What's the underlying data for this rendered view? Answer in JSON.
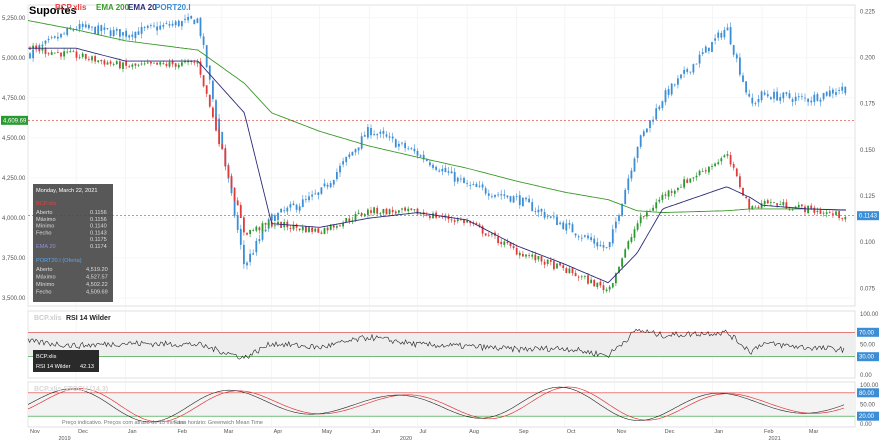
{
  "title": "Suportes",
  "legend": [
    {
      "label": "BCP.xlis",
      "color": "#e8403f"
    },
    {
      "label": "EMA 200",
      "color": "#3a9a2a"
    },
    {
      "label": "EMA 20",
      "color": "#2a2a7a"
    },
    {
      "label": "PORT20.I",
      "color": "#3b8ed6"
    }
  ],
  "colors": {
    "up": "#2a9a30",
    "down": "#e03a3a",
    "index": "#3b8ed6",
    "ema200": "#3a9a2a",
    "ema20": "#2a2a7a",
    "rsi": "#222222",
    "stoch_k": "#222222",
    "stoch_d": "#e03a3a"
  },
  "tooltip": {
    "date": "Monday, March 22, 2021",
    "bcp_label": "BCP.xlis",
    "bcp_rows": [
      [
        "Aberto",
        "0.1156"
      ],
      [
        "Máximo",
        "0.1156"
      ],
      [
        "Mínimo",
        "0.1140"
      ],
      [
        "Fecho",
        "0.1143"
      ]
    ],
    "ema200_value": "0.1175",
    "ema20_label": "EMA 20",
    "ema20_value": "0.1174",
    "port_label": "PORT20.I (Oferta)",
    "port_rows": [
      [
        "Aberto",
        "4,519.20"
      ],
      [
        "Máximo",
        "4,527.57"
      ],
      [
        "Mínimo",
        "4,502.22"
      ],
      [
        "Fecho",
        "4,509.69"
      ]
    ]
  },
  "rsi_panel": {
    "labels": [
      "BCP.xlis",
      "RSI 14 Wilder"
    ],
    "box_line1": "BCP.xlis",
    "box_label": "RSI 14 Wilder",
    "box_value": "42.13",
    "levels": [
      70,
      30
    ],
    "ticks": [
      "100.00",
      "50.00",
      "0.00"
    ]
  },
  "stoch_panel": {
    "label": "BCP.xlis  STOCH (14,3)",
    "levels": [
      80,
      20
    ],
    "ticks": [
      "100.00",
      "50.00",
      "0.00"
    ]
  },
  "footer": {
    "note": "Preço indicativo. Preços com atraso de 15 minutos",
    "tz": "Fuso horário: Greenwich Mean Time"
  },
  "chart_data": {
    "type": "line",
    "title": "Suportes",
    "x_months": [
      "Nov",
      "Dec",
      "Jan",
      "Feb",
      "Mar",
      "Apr",
      "May",
      "Jun",
      "Jul",
      "Aug",
      "Sep",
      "Oct",
      "Nov",
      "Dec",
      "Jan",
      "Feb",
      "Mar"
    ],
    "x_years": [
      "2019",
      "2020",
      "2021"
    ],
    "left_axis": {
      "ticks": [
        "5,250.00",
        "5,000.00",
        "4,750.00",
        "4,500.00",
        "4,250.00",
        "4,000.00",
        "3,750.00",
        "3,500.00"
      ],
      "range": [
        3450,
        5330
      ]
    },
    "right_axis": {
      "ticks": [
        "0.225",
        "0.200",
        "0.175",
        "0.150",
        "0.125",
        "0.100",
        "0.075"
      ],
      "range": [
        0.0654,
        0.2284
      ]
    },
    "price_marker_left": "4,609.69",
    "price_marker_right": "0.1143",
    "series": [
      {
        "name": "PORT20.I",
        "axis": "left",
        "x": [
          "2019-11",
          "2019-12",
          "2020-01",
          "2020-02-15",
          "2020-03-15",
          "2020-04",
          "2020-05",
          "2020-06",
          "2020-07",
          "2020-08",
          "2020-09",
          "2020-10",
          "2020-10-28",
          "2020-11-15",
          "2020-12",
          "2021-01-10",
          "2021-01-25",
          "2021-02",
          "2021-03",
          "2021-03-22"
        ],
        "values": [
          5020,
          5190,
          5150,
          5240,
          3700,
          4000,
          4150,
          4550,
          4400,
          4200,
          4120,
          3950,
          3800,
          4450,
          4750,
          5190,
          4700,
          4770,
          4740,
          4809
        ]
      },
      {
        "name": "BCP.xlis",
        "axis": "right",
        "x": [
          "2019-11",
          "2019-12",
          "2020-01",
          "2020-02-15",
          "2020-03-15",
          "2020-04",
          "2020-05",
          "2020-06",
          "2020-07",
          "2020-08",
          "2020-09",
          "2020-10",
          "2020-10-28",
          "2020-11-15",
          "2020-12",
          "2021-01-10",
          "2021-01-25",
          "2021-02",
          "2021-03",
          "2021-03-22"
        ],
        "values": [
          0.205,
          0.201,
          0.195,
          0.197,
          0.105,
          0.11,
          0.106,
          0.117,
          0.116,
          0.111,
          0.095,
          0.085,
          0.074,
          0.11,
          0.125,
          0.147,
          0.117,
          0.122,
          0.118,
          0.1143
        ]
      },
      {
        "name": "EMA 200",
        "axis": "right",
        "x": [
          "2019-11",
          "2019-12",
          "2020-01",
          "2020-02-15",
          "2020-03-15",
          "2020-04",
          "2020-05",
          "2020-06",
          "2020-07",
          "2020-08",
          "2020-09",
          "2020-10",
          "2020-10-28",
          "2020-11-15",
          "2020-12",
          "2021-01-10",
          "2021-01-25",
          "2021-02",
          "2021-03",
          "2021-03-22"
        ],
        "values": [
          0.22,
          0.215,
          0.209,
          0.204,
          0.186,
          0.17,
          0.16,
          0.152,
          0.146,
          0.14,
          0.133,
          0.127,
          0.123,
          0.117,
          0.116,
          0.117,
          0.118,
          0.118,
          0.118,
          0.1175
        ]
      },
      {
        "name": "EMA 20",
        "axis": "right",
        "x": [
          "2019-11",
          "2019-12",
          "2020-01",
          "2020-02-15",
          "2020-03-15",
          "2020-04",
          "2020-05",
          "2020-06",
          "2020-07",
          "2020-08",
          "2020-09",
          "2020-10",
          "2020-10-28",
          "2020-11-15",
          "2020-12",
          "2021-01-10",
          "2021-01-25",
          "2021-02",
          "2021-03",
          "2021-03-22"
        ],
        "values": [
          0.205,
          0.205,
          0.198,
          0.198,
          0.17,
          0.11,
          0.108,
          0.113,
          0.116,
          0.112,
          0.098,
          0.088,
          0.078,
          0.094,
          0.118,
          0.13,
          0.124,
          0.12,
          0.118,
          0.1174
        ]
      },
      {
        "name": "RSI 14 Wilder",
        "x": [
          "2019-11",
          "2019-12",
          "2020-01",
          "2020-02-15",
          "2020-03-15",
          "2020-04",
          "2020-05",
          "2020-06",
          "2020-07",
          "2020-08",
          "2020-09",
          "2020-10",
          "2020-10-28",
          "2020-11-15",
          "2020-12",
          "2021-01-10",
          "2021-01-25",
          "2021-02",
          "2021-03",
          "2021-03-22"
        ],
        "values": [
          55,
          48,
          52,
          50,
          28,
          52,
          45,
          62,
          50,
          47,
          42,
          44,
          32,
          74,
          65,
          70,
          38,
          52,
          45,
          42.13
        ]
      }
    ]
  }
}
